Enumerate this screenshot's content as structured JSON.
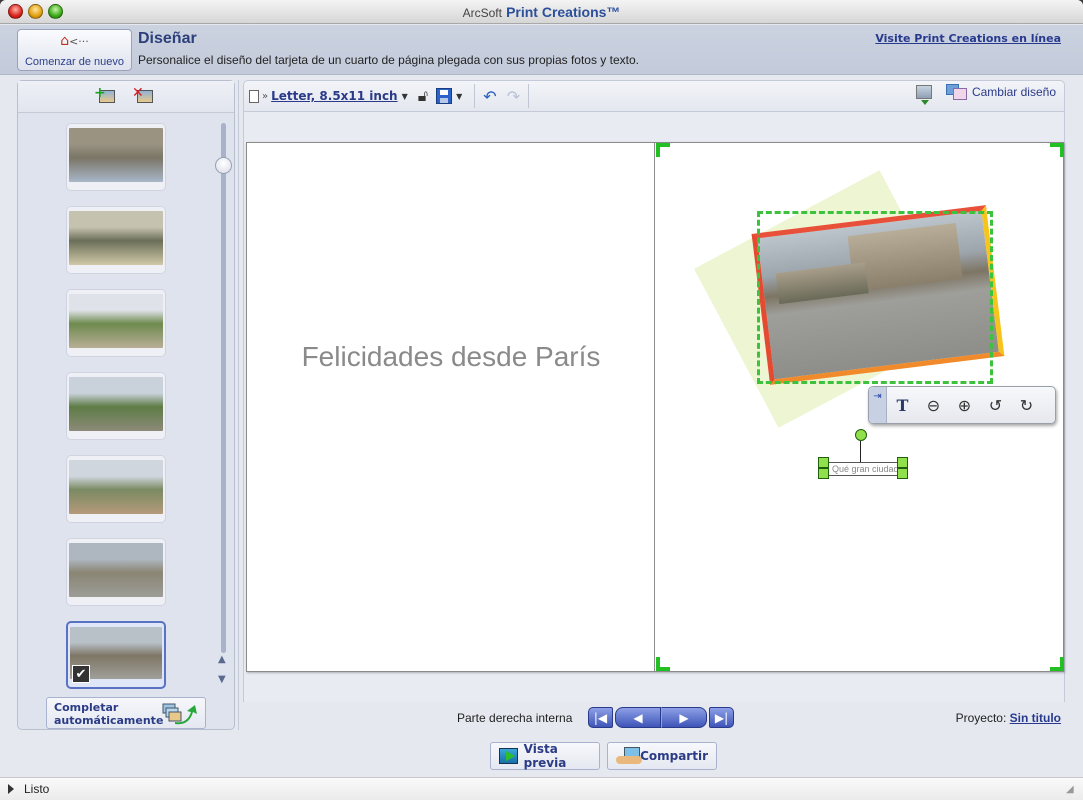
{
  "window": {
    "title_brand": "ArcSoft",
    "title_product": "Print Creations™"
  },
  "header": {
    "start_over_label": "Comenzar de nuevo",
    "title": "Diseñar",
    "subtitle": "Personalice el diseño del tarjeta de un cuarto de página plegada con sus propias fotos y texto.",
    "online_link": "Visite Print Creations en línea"
  },
  "left_panel": {
    "add_photo": "add-photo",
    "remove_photo": "remove-photo",
    "thumbnails": [
      {
        "name": "Notre-Dame facade",
        "colors": [
          "#9a9382",
          "#7a7566",
          "#a9b7c9"
        ]
      },
      {
        "name": "Park with people",
        "colors": [
          "#c6c2b0",
          "#6a6f58",
          "#d0c8a8"
        ]
      },
      {
        "name": "Tree rotated",
        "colors": [
          "#dfe2e8",
          "#6e8a4e",
          "#b8ae96"
        ]
      },
      {
        "name": "Garden square",
        "colors": [
          "#c9d2da",
          "#5e7c46",
          "#8c8a78"
        ]
      },
      {
        "name": "Street with flowers",
        "colors": [
          "#cfd6de",
          "#7a8a62",
          "#b59a7a"
        ]
      },
      {
        "name": "Plaza buildings",
        "colors": [
          "#aeb6bf",
          "#8a8574",
          "#9d9d98"
        ]
      },
      {
        "name": "Plaza selected",
        "colors": [
          "#b8c0c8",
          "#7e7665",
          "#a09f9a"
        ],
        "selected": true
      }
    ],
    "slider_value": 0.08,
    "autofill_label": "Completar automáticamente"
  },
  "toolbar": {
    "paper_size": "Letter, 8.5x11 inch",
    "change_design": "Cambiar diseño"
  },
  "canvas": {
    "left_text": "Felicidades desde París",
    "textbox_text": "Qué gran ciudad",
    "photo_toolbar": [
      "pin",
      "text-edit",
      "zoom-out",
      "zoom-in",
      "rotate-left",
      "rotate-right"
    ]
  },
  "bottom": {
    "page_label": "Parte derecha interna",
    "project_label": "Proyecto:",
    "project_name": "Sin titulo",
    "preview_label": "Vista previa",
    "share_label": "Compartir"
  },
  "status": {
    "text": "Listo"
  }
}
